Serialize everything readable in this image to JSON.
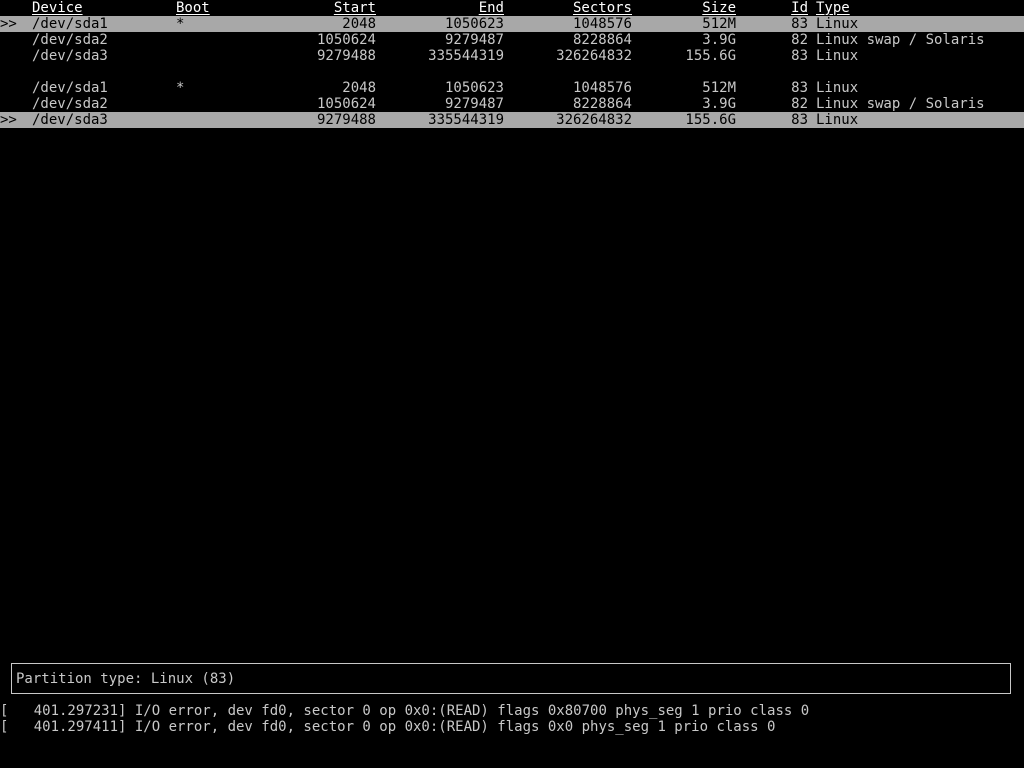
{
  "headers": {
    "device": "Device",
    "boot": "Boot",
    "start": "Start",
    "end": "End",
    "sectors": "Sectors",
    "size": "Size",
    "id": "Id",
    "type": "Type"
  },
  "table1": [
    {
      "marker": ">>",
      "selected": true,
      "device": "/dev/sda1",
      "boot": "*",
      "start": "2048",
      "end": "1050623",
      "sectors": "1048576",
      "size": "512M",
      "id": "83",
      "type": "Linux"
    },
    {
      "marker": "",
      "selected": false,
      "device": "/dev/sda2",
      "boot": "",
      "start": "1050624",
      "end": "9279487",
      "sectors": "8228864",
      "size": "3.9G",
      "id": "82",
      "type": "Linux swap / Solaris"
    },
    {
      "marker": "",
      "selected": false,
      "device": "/dev/sda3",
      "boot": "",
      "start": "9279488",
      "end": "335544319",
      "sectors": "326264832",
      "size": "155.6G",
      "id": "83",
      "type": "Linux"
    }
  ],
  "table2": [
    {
      "marker": "",
      "selected": false,
      "device": "/dev/sda1",
      "boot": "*",
      "start": "2048",
      "end": "1050623",
      "sectors": "1048576",
      "size": "512M",
      "id": "83",
      "type": "Linux"
    },
    {
      "marker": "",
      "selected": false,
      "device": "/dev/sda2",
      "boot": "",
      "start": "1050624",
      "end": "9279487",
      "sectors": "8228864",
      "size": "3.9G",
      "id": "82",
      "type": "Linux swap / Solaris"
    },
    {
      "marker": ">>",
      "selected": true,
      "device": "/dev/sda3",
      "boot": "",
      "start": "9279488",
      "end": "335544319",
      "sectors": "326264832",
      "size": "155.6G",
      "id": "83",
      "type": "Linux"
    }
  ],
  "info": {
    "text": "Partition type: Linux (83)"
  },
  "log": [
    "[   401.297231] I/O error, dev fd0, sector 0 op 0x0:(READ) flags 0x80700 phys_seg 1 prio class 0",
    "[   401.297411] I/O error, dev fd0, sector 0 op 0x0:(READ) flags 0x0 phys_seg 1 prio class 0"
  ],
  "colors": {
    "background": "#000000",
    "foreground": "#c8c8c8",
    "selection": "#a8a8a8"
  }
}
